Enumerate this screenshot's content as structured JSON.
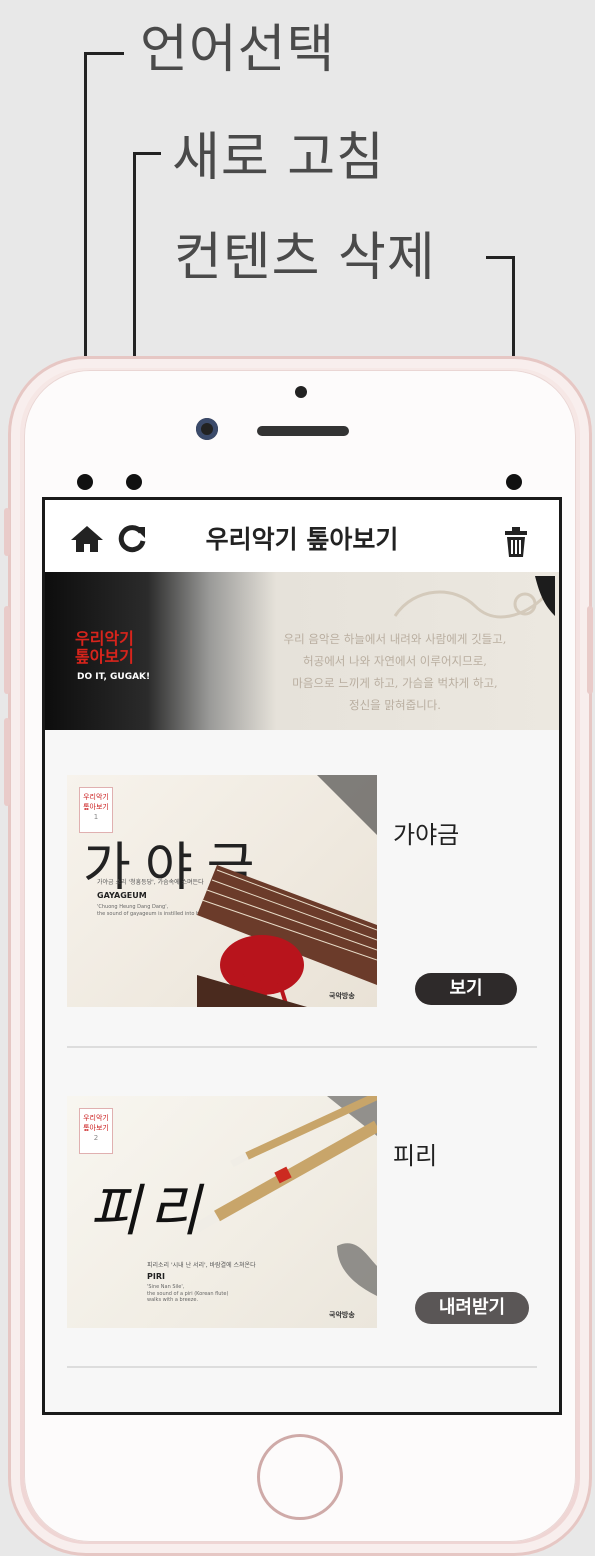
{
  "callouts": {
    "language": "언어선택",
    "refresh": "새로 고침",
    "delete": "컨텐츠 삭제"
  },
  "app": {
    "title": "우리악기 톺아보기",
    "icons": [
      "home-icon",
      "refresh-icon",
      "trash-icon"
    ]
  },
  "banner": {
    "logo_line1": "우리악기",
    "logo_line2": "톺아보기",
    "logo_sub": "DO IT, GUGAK!",
    "text_lines": [
      "우리 음악은 하늘에서 내려와 사람에게 깃들고,",
      "허공에서 나와 자연에서 이루어지므로,",
      "마음으로 느끼게 하고, 가슴을 벅차게 하고,",
      "정신을 맑혀줍니다."
    ]
  },
  "items": [
    {
      "name": "가야금",
      "action": "보기",
      "thumb_calligraphy": "가야금",
      "thumb_caption": "가야금 소리 '청흥등당', 가슴속에 스며든다",
      "thumb_title": "GAYAGEUM",
      "thumb_en": "'Chuong Heung Dang Dang',",
      "thumb_en2": "the sound of gayageum is instilled into heart.",
      "badge_num": "1",
      "brand": "국악방송"
    },
    {
      "name": "피리",
      "action": "내려받기",
      "thumb_calligraphy": "피리",
      "thumb_caption": "피리소리 '시내 난 서리', 바람결에 스쳐온다",
      "thumb_title": "PIRI",
      "thumb_en": "'Sine Nan Sile',",
      "thumb_en2": "the sound of a piri (Korean flute) walks with a breeze.",
      "badge_num": "2",
      "brand": "국악방송"
    }
  ],
  "colors": {
    "accent_red": "#d8241c",
    "button_dark": "#2e2a2a",
    "phone_rose": "#f3dede"
  }
}
